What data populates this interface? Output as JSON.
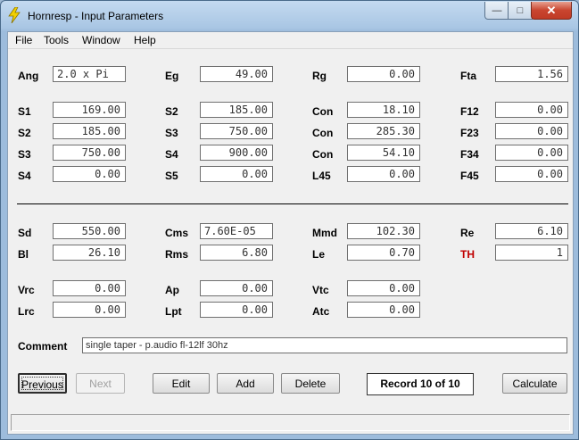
{
  "window": {
    "title": "Hornresp - Input Parameters",
    "controls": {
      "minimize": "—",
      "maximize": "□",
      "close": "✕"
    }
  },
  "menu": [
    "File",
    "Tools",
    "Window",
    "Help"
  ],
  "params": {
    "Ang": "2.0 x Pi",
    "Eg": "49.00",
    "Rg": "0.00",
    "Fta": "1.56",
    "S1": "169.00",
    "S2a": "185.00",
    "Con1": "18.10",
    "F12": "0.00",
    "S2b": "185.00",
    "S3a": "750.00",
    "Con2": "285.30",
    "F23": "0.00",
    "S3b": "750.00",
    "S4a": "900.00",
    "Con3": "54.10",
    "F34": "0.00",
    "S4b": "0.00",
    "S5": "0.00",
    "L45": "0.00",
    "F45": "0.00",
    "Sd": "550.00",
    "Cms": "7.60E-05",
    "Mmd": "102.30",
    "Re": "6.10",
    "Bl": "26.10",
    "Rms": "6.80",
    "Le": "0.70",
    "TH": "1",
    "Vrc": "0.00",
    "Ap": "0.00",
    "Vtc": "0.00",
    "Lrc": "0.00",
    "Lpt": "0.00",
    "Atc": "0.00"
  },
  "labels": {
    "Ang": "Ang",
    "Eg": "Eg",
    "Rg": "Rg",
    "Fta": "Fta",
    "S1": "S1",
    "S2": "S2",
    "S3": "S3",
    "S4": "S4",
    "S5": "S5",
    "Con": "Con",
    "L45": "L45",
    "F12": "F12",
    "F23": "F23",
    "F34": "F34",
    "F45": "F45",
    "Sd": "Sd",
    "Cms": "Cms",
    "Mmd": "Mmd",
    "Re": "Re",
    "Bl": "Bl",
    "Rms": "Rms",
    "Le": "Le",
    "TH": "TH",
    "Vrc": "Vrc",
    "Ap": "Ap",
    "Vtc": "Vtc",
    "Lrc": "Lrc",
    "Lpt": "Lpt",
    "Atc": "Atc",
    "Comment": "Comment"
  },
  "comment": "single taper - p.audio fl-12lf 30hz",
  "buttons": {
    "previous": "Previous",
    "next": "Next",
    "edit": "Edit",
    "add": "Add",
    "delete": "Delete",
    "calculate": "Calculate"
  },
  "record": "Record 10 of 10",
  "status": "",
  "colors": {
    "accent_red": "#c00000"
  }
}
